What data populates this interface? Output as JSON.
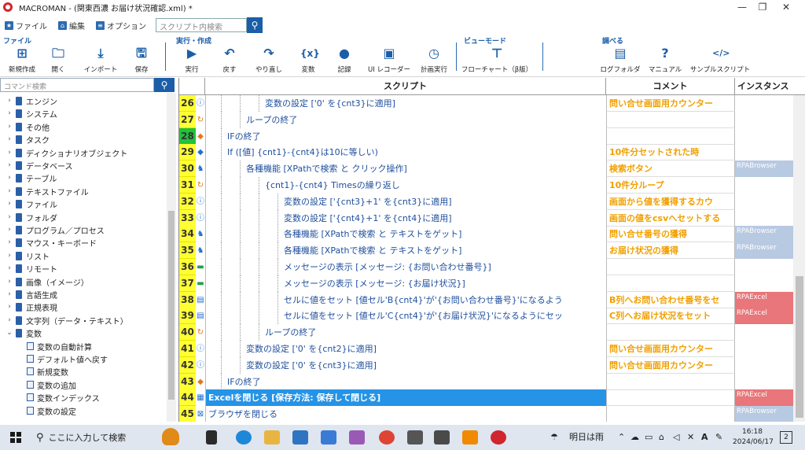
{
  "window": {
    "title": "MACROMAN - (関東西濃 お届け状況確認.xml) *",
    "controls": [
      "—",
      "❐",
      "✕"
    ]
  },
  "menu": {
    "items": [
      {
        "label": "ファイル",
        "icon": "star-icon"
      },
      {
        "label": "編集",
        "icon": "home-icon"
      },
      {
        "label": "オプション",
        "icon": "list-icon"
      }
    ],
    "search_placeholder": "スクリプト内検索"
  },
  "ribbon": {
    "groups": {
      "file": "ファイル",
      "run": "実行・作成",
      "view": "ビューモード",
      "lookup": "調べる"
    },
    "buttons": [
      {
        "label": "新規作成",
        "icon": "new-doc-icon",
        "glyph": "⊞"
      },
      {
        "label": "開く",
        "icon": "folder-icon",
        "glyph": "🗀"
      },
      {
        "label": "インポート",
        "icon": "import-icon",
        "glyph": "⤓"
      },
      {
        "label": "保存",
        "icon": "save-icon",
        "glyph": "🖫"
      },
      {
        "label": "実行",
        "icon": "play-icon",
        "glyph": "▶"
      },
      {
        "label": "戻す",
        "icon": "undo-icon",
        "glyph": "↶"
      },
      {
        "label": "やり直し",
        "icon": "redo-icon",
        "glyph": "↷"
      },
      {
        "label": "変数",
        "icon": "variable-icon",
        "glyph": "{x}"
      },
      {
        "label": "記録",
        "icon": "record-icon",
        "glyph": "●"
      },
      {
        "label": "UI レコーダー",
        "icon": "ui-recorder-icon",
        "glyph": "▣"
      },
      {
        "label": "計画実行",
        "icon": "schedule-icon",
        "glyph": "◷"
      },
      {
        "label": "フローチャート（β版）",
        "icon": "flowchart-icon",
        "glyph": "⊤"
      },
      {
        "label": "ログフォルダ",
        "icon": "log-folder-icon",
        "glyph": "▤"
      },
      {
        "label": "マニュアル",
        "icon": "help-icon",
        "glyph": "?"
      },
      {
        "label": "サンプルスクリプト",
        "icon": "sample-script-icon",
        "glyph": "</>"
      }
    ]
  },
  "left_panel": {
    "search_placeholder": "コマンド検索",
    "categories": [
      "エンジン",
      "システム",
      "その他",
      "タスク",
      "ディクショナリオブジェクト",
      "データベース",
      "テーブル",
      "テキストファイル",
      "ファイル",
      "フォルダ",
      "プログラム／プロセス",
      "マウス・キーボード",
      "リスト",
      "リモート",
      "画像（イメージ）",
      "言語生成",
      "正規表現",
      "文字列（データ・テキスト）"
    ],
    "expanded": "変数",
    "sub_items": [
      "変数の自動計算",
      "デフォルト値へ戻す",
      "新規変数",
      "変数の追加",
      "変数インデックス",
      "変数の設定"
    ]
  },
  "grid": {
    "headers": {
      "script": "スクリプト",
      "comment": "コメント",
      "instance": "インスタンス"
    },
    "rows": [
      {
        "num": "26",
        "indent": 3,
        "icon": "info",
        "text": "変数の設定 ['0' を{cnt3}に適用]",
        "comment": "問い合せ画面用カウンター",
        "instance": ""
      },
      {
        "num": "27",
        "indent": 2,
        "icon": "loop",
        "text": "ループの終了",
        "comment": "",
        "instance": ""
      },
      {
        "num": "28",
        "indent": 1,
        "icon": "diamond-orange",
        "text": "IFの終了",
        "comment": "",
        "instance": "",
        "green": true
      },
      {
        "num": "29",
        "indent": 1,
        "icon": "diamond-blue",
        "text": "If ([値] {cnt1}-{cnt4}は10に等しい)",
        "comment": "10件分セットされた時",
        "instance": ""
      },
      {
        "num": "30",
        "indent": 2,
        "icon": "person",
        "text": "各種機能 [XPathで検索 と クリック操作]",
        "comment": "検索ボタン",
        "instance": "RPABrowser",
        "inscolor": "blue"
      },
      {
        "num": "31",
        "indent": 3,
        "icon": "loop",
        "text": "{cnt1}-{cnt4} Timesの繰り返し",
        "comment": "10件分ループ",
        "instance": ""
      },
      {
        "num": "32",
        "indent": 4,
        "icon": "info",
        "text": "変数の設定 ['{cnt3}+1' を{cnt3}に適用]",
        "comment": "画面から値を獲得するカウ",
        "instance": ""
      },
      {
        "num": "33",
        "indent": 4,
        "icon": "info",
        "text": "変数の設定 ['{cnt4}+1' を{cnt4}に適用]",
        "comment": "画面の値をcsvへセットする",
        "instance": ""
      },
      {
        "num": "34",
        "indent": 4,
        "icon": "person",
        "text": "各種機能 [XPathで検索 と テキストをゲット]",
        "comment": "問い合せ番号の獲得",
        "instance": "RPABrowser",
        "inscolor": "blue"
      },
      {
        "num": "35",
        "indent": 4,
        "icon": "person",
        "text": "各種機能 [XPathで検索 と テキストをゲット]",
        "comment": "お届け状況の獲得",
        "instance": "RPABrowser",
        "inscolor": "blue"
      },
      {
        "num": "36",
        "indent": 4,
        "icon": "message",
        "text": "メッセージの表示 [メッセージ: {お問い合わせ番号}]",
        "comment": "",
        "instance": ""
      },
      {
        "num": "37",
        "indent": 4,
        "icon": "message",
        "text": "メッセージの表示 [メッセージ: {お届け状況}]",
        "comment": "",
        "instance": ""
      },
      {
        "num": "38",
        "indent": 4,
        "icon": "excel",
        "text": "セルに値をセット [値セル'B{cnt4}'が'{お問い合わせ番号}'になるよう",
        "comment": "B列へお問い合わせ番号をセ",
        "instance": "RPAExcel",
        "inscolor": "red"
      },
      {
        "num": "39",
        "indent": 4,
        "icon": "excel",
        "text": "セルに値をセット [値セル'C{cnt4}'が'{お届け状況}'になるようにセッ",
        "comment": "C列へお届け状況をセット",
        "instance": "RPAExcel",
        "inscolor": "red"
      },
      {
        "num": "40",
        "indent": 3,
        "icon": "loop",
        "text": "ループの終了",
        "comment": "",
        "instance": ""
      },
      {
        "num": "41",
        "indent": 2,
        "icon": "info",
        "text": "変数の設定 ['0' を{cnt2}に適用]",
        "comment": "問い合せ画面用カウンター",
        "instance": ""
      },
      {
        "num": "42",
        "indent": 2,
        "icon": "info",
        "text": "変数の設定 ['0' を{cnt3}に適用]",
        "comment": "問い合せ画面用カウンター",
        "instance": ""
      },
      {
        "num": "43",
        "indent": 1,
        "icon": "diamond-orange",
        "text": "IFの終了",
        "comment": "",
        "instance": ""
      },
      {
        "num": "44",
        "indent": 0,
        "icon": "grid",
        "text": "Excelを閉じる [保存方法: 保存して閉じる]",
        "comment": "",
        "instance": "RPAExcel",
        "inscolor": "red",
        "selected": true
      },
      {
        "num": "45",
        "indent": 0,
        "icon": "close",
        "text": "ブラウザを閉じる",
        "comment": "",
        "instance": "RPABrowser",
        "inscolor": "blue"
      }
    ]
  },
  "taskbar": {
    "search_text": "ここに入力して検索",
    "weather": "明日は雨",
    "ime": "A",
    "time": "16:18",
    "date": "2024/06/17",
    "notifications": "2"
  }
}
